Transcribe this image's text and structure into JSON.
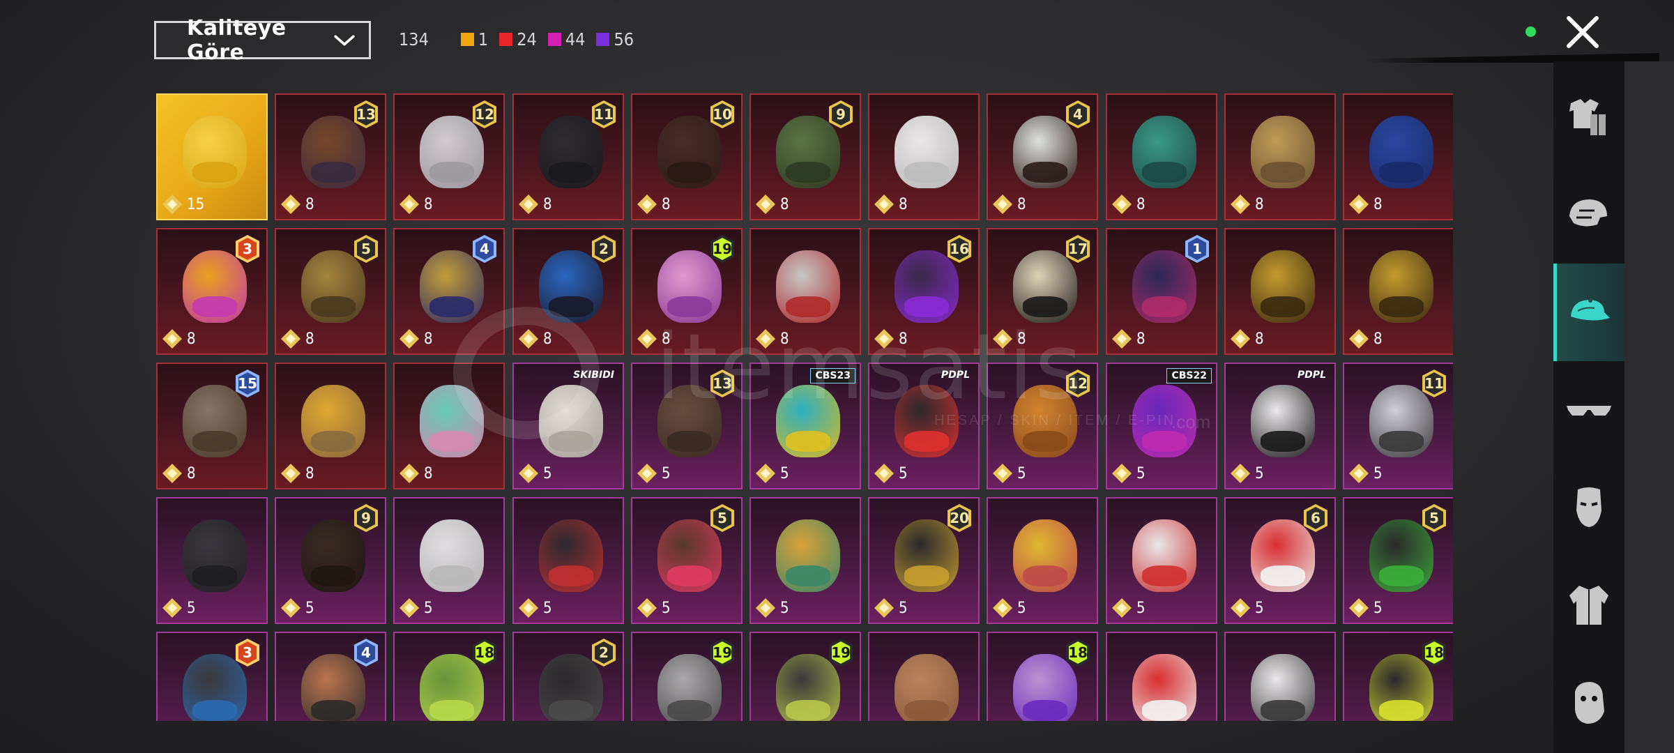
{
  "toolbar": {
    "sort_label": "Kaliteye Göre",
    "total": "134",
    "rarity_counts": [
      {
        "color": "#f1a60f",
        "count": "1"
      },
      {
        "color": "#e8262b",
        "count": "24"
      },
      {
        "color": "#d61fb6",
        "count": "44"
      },
      {
        "color": "#7b2ee0",
        "count": "56"
      }
    ],
    "status_color": "#2fdc5e"
  },
  "sidebar": {
    "items": [
      {
        "icon": "outfit-icon",
        "active": false
      },
      {
        "icon": "helmet-icon",
        "active": false
      },
      {
        "icon": "cap-icon",
        "active": true
      },
      {
        "icon": "glasses-icon",
        "active": false
      },
      {
        "icon": "mask-icon",
        "active": false
      },
      {
        "icon": "jacket-icon",
        "active": false
      },
      {
        "icon": "face-icon",
        "active": false
      }
    ]
  },
  "watermark": {
    "brand": "itemsatis",
    "tagline": "HESAP / SKIN / ITEM / E-PIN",
    "suffix": ".com"
  },
  "items": [
    {
      "rarity": "gold",
      "cost": "15",
      "badge": "",
      "tag": "",
      "tag_style": "",
      "art": "#f6d34a",
      "art2": "#d9a314"
    },
    {
      "rarity": "red",
      "cost": "8",
      "badge": "13",
      "badge_style": "dark",
      "art": "#7a4a2a",
      "art2": "#3a2a40"
    },
    {
      "rarity": "red",
      "cost": "8",
      "badge": "12",
      "badge_style": "dark",
      "art": "#d8d4d8",
      "art2": "#9c9aa0"
    },
    {
      "rarity": "red",
      "cost": "8",
      "badge": "11",
      "badge_style": "dark",
      "art": "#2c2c30",
      "art2": "#1a1a1e"
    },
    {
      "rarity": "red",
      "cost": "8",
      "badge": "10",
      "badge_style": "dark",
      "art": "#4a2e28",
      "art2": "#2a1a16"
    },
    {
      "rarity": "red",
      "cost": "8",
      "badge": "9",
      "badge_style": "dark",
      "art": "#5c7a4a",
      "art2": "#2e3a22"
    },
    {
      "rarity": "red",
      "cost": "8",
      "badge": "",
      "badge_style": "",
      "art": "#f2f2f2",
      "art2": "#bdbdbd"
    },
    {
      "rarity": "red",
      "cost": "8",
      "badge": "4",
      "badge_style": "dark",
      "art": "#e6ece6",
      "art2": "#2a1a1a"
    },
    {
      "rarity": "red",
      "cost": "8",
      "badge": "",
      "badge_style": "",
      "art": "#3aa08a",
      "art2": "#1c4a46"
    },
    {
      "rarity": "red",
      "cost": "8",
      "badge": "",
      "badge_style": "",
      "art": "#c7a25a",
      "art2": "#6a5230"
    },
    {
      "rarity": "red",
      "cost": "8",
      "badge": "",
      "badge_style": "",
      "art": "#2a4aa8",
      "art2": "#1a2a6a"
    },
    {
      "rarity": "red",
      "cost": "8",
      "badge": "3",
      "badge_style": "orange",
      "art": "#f2a81e",
      "art2": "#c43ab0"
    },
    {
      "rarity": "red",
      "cost": "8",
      "badge": "5",
      "badge_style": "dark",
      "art": "#a98a40",
      "art2": "#4a3a20"
    },
    {
      "rarity": "red",
      "cost": "8",
      "badge": "4",
      "badge_style": "blue",
      "art": "#c8a43a",
      "art2": "#2a2a6a"
    },
    {
      "rarity": "red",
      "cost": "8",
      "badge": "2",
      "badge_style": "dark",
      "art": "#2a6ac8",
      "art2": "#1a1a2a"
    },
    {
      "rarity": "red",
      "cost": "8",
      "badge": "19",
      "badge_style": "lime",
      "art": "#e8a0d6",
      "art2": "#8a3a9a"
    },
    {
      "rarity": "red",
      "cost": "8",
      "badge": "",
      "badge_style": "",
      "art": "#cfcfcf",
      "art2": "#b02a2a"
    },
    {
      "rarity": "red",
      "cost": "8",
      "badge": "16",
      "badge_style": "dark",
      "art": "#3a2a4a",
      "art2": "#8a2ad6"
    },
    {
      "rarity": "red",
      "cost": "8",
      "badge": "17",
      "badge_style": "dark",
      "art": "#e8dcc0",
      "art2": "#1a1a1a"
    },
    {
      "rarity": "red",
      "cost": "8",
      "badge": "1",
      "badge_style": "blue",
      "art": "#2a2a5a",
      "art2": "#b02a6a"
    },
    {
      "rarity": "red",
      "cost": "8",
      "badge": "",
      "badge_style": "",
      "art": "#c9a230",
      "art2": "#3a2a10"
    },
    {
      "rarity": "red",
      "cost": "8",
      "badge": "",
      "badge_style": "",
      "art": "#c9a230",
      "art2": "#3a2a10"
    },
    {
      "rarity": "red",
      "cost": "8",
      "badge": "15",
      "badge_style": "blue",
      "art": "#8a7a6a",
      "art2": "#4a3a2a"
    },
    {
      "rarity": "red",
      "cost": "8",
      "badge": "",
      "badge_style": "",
      "art": "#e8b030",
      "art2": "#8a6a40"
    },
    {
      "rarity": "red",
      "cost": "8",
      "badge": "",
      "badge_style": "",
      "art": "#6ad6c0",
      "art2": "#d68ab0"
    },
    {
      "rarity": "purple",
      "cost": "5",
      "badge": "",
      "tag": "SKIBIDI",
      "tag_style": "plain",
      "art": "#e8e4dc",
      "art2": "#a8a49c"
    },
    {
      "rarity": "purple",
      "cost": "5",
      "badge": "13",
      "badge_style": "dark",
      "art": "#6a5040",
      "art2": "#3a2a20"
    },
    {
      "rarity": "purple",
      "cost": "5",
      "badge": "",
      "tag": "CBS23",
      "tag_style": "box",
      "art": "#2ab8c8",
      "art2": "#e0c020"
    },
    {
      "rarity": "purple",
      "cost": "5",
      "badge": "",
      "tag": "PDPL",
      "tag_style": "plain",
      "art": "#2a2a2a",
      "art2": "#e03030"
    },
    {
      "rarity": "purple",
      "cost": "5",
      "badge": "12",
      "badge_style": "dark",
      "art": "#d88a30",
      "art2": "#8a4a1a"
    },
    {
      "rarity": "purple",
      "cost": "5",
      "badge": "",
      "tag": "CBS22",
      "tag_style": "box",
      "art": "#6a2ac0",
      "art2": "#c02ab0"
    },
    {
      "rarity": "purple",
      "cost": "5",
      "badge": "",
      "tag": "PDPL",
      "tag_style": "plain",
      "art": "#f2f2f2",
      "art2": "#1a1a1a"
    },
    {
      "rarity": "purple",
      "cost": "5",
      "badge": "11",
      "badge_style": "dark",
      "art": "#d8d8e0",
      "art2": "#3a3a3a"
    },
    {
      "rarity": "purple",
      "cost": "5",
      "badge": "",
      "badge_style": "",
      "art": "#3a3a3e",
      "art2": "#1e1e22"
    },
    {
      "rarity": "purple",
      "cost": "5",
      "badge": "9",
      "badge_style": "dark",
      "art": "#3a2a24",
      "art2": "#1e1612"
    },
    {
      "rarity": "purple",
      "cost": "5",
      "badge": "",
      "badge_style": "",
      "art": "#e8e8e8",
      "art2": "#b8b8b8"
    },
    {
      "rarity": "purple",
      "cost": "5",
      "badge": "",
      "badge_style": "",
      "art": "#2a2a30",
      "art2": "#c03030"
    },
    {
      "rarity": "purple",
      "cost": "5",
      "badge": "5",
      "badge_style": "dark",
      "art": "#5a3a2a",
      "art2": "#e03a60"
    },
    {
      "rarity": "purple",
      "cost": "5",
      "badge": "",
      "badge_style": "",
      "art": "#e0a83a",
      "art2": "#3a8a6a"
    },
    {
      "rarity": "purple",
      "cost": "5",
      "badge": "20",
      "badge_style": "dark",
      "art": "#2a2a2a",
      "art2": "#c8a030"
    },
    {
      "rarity": "purple",
      "cost": "5",
      "badge": "",
      "badge_style": "",
      "art": "#e8c030",
      "art2": "#c04a4a"
    },
    {
      "rarity": "purple",
      "cost": "5",
      "badge": "",
      "badge_style": "",
      "art": "#f2f2f2",
      "art2": "#d03030"
    },
    {
      "rarity": "purple",
      "cost": "5",
      "badge": "6",
      "badge_style": "dark",
      "art": "#e03030",
      "art2": "#f2f2f2"
    },
    {
      "rarity": "purple",
      "cost": "5",
      "badge": "5",
      "badge_style": "dark",
      "art": "#2a2a2a",
      "art2": "#3ab03a"
    },
    {
      "rarity": "purple",
      "cost": "",
      "badge": "3",
      "badge_style": "orange",
      "art": "#3a3a3a",
      "art2": "#2a6ab0"
    },
    {
      "rarity": "purple",
      "cost": "",
      "badge": "4",
      "badge_style": "blue",
      "art": "#c07a50",
      "art2": "#2a2a2a"
    },
    {
      "rarity": "purple",
      "cost": "",
      "badge": "18",
      "badge_style": "lime",
      "art": "#6a9a3a",
      "art2": "#b8d84a"
    },
    {
      "rarity": "purple",
      "cost": "",
      "badge": "2",
      "badge_style": "dark",
      "art": "#2a2a2a",
      "art2": "#4a4a4a"
    },
    {
      "rarity": "purple",
      "cost": "",
      "badge": "19",
      "badge_style": "lime",
      "art": "#b0b0b0",
      "art2": "#4a4a4a"
    },
    {
      "rarity": "purple",
      "cost": "",
      "badge": "19",
      "badge_style": "lime",
      "art": "#3a3a3a",
      "art2": "#b8c84a"
    },
    {
      "rarity": "purple",
      "cost": "",
      "badge": "",
      "badge_style": "",
      "art": "#c08a60",
      "art2": "#8a5a3a"
    },
    {
      "rarity": "purple",
      "cost": "",
      "badge": "18",
      "badge_style": "lime",
      "art": "#c09ad8",
      "art2": "#6a2ac0"
    },
    {
      "rarity": "purple",
      "cost": "",
      "badge": "",
      "badge_style": "",
      "art": "#e03030",
      "art2": "#f2f2f2"
    },
    {
      "rarity": "purple",
      "cost": "",
      "badge": "",
      "badge_style": "",
      "art": "#f2f2f2",
      "art2": "#3a3a3a"
    },
    {
      "rarity": "purple",
      "cost": "",
      "badge": "18",
      "badge_style": "lime",
      "art": "#2a2a2a",
      "art2": "#d8e030"
    }
  ]
}
